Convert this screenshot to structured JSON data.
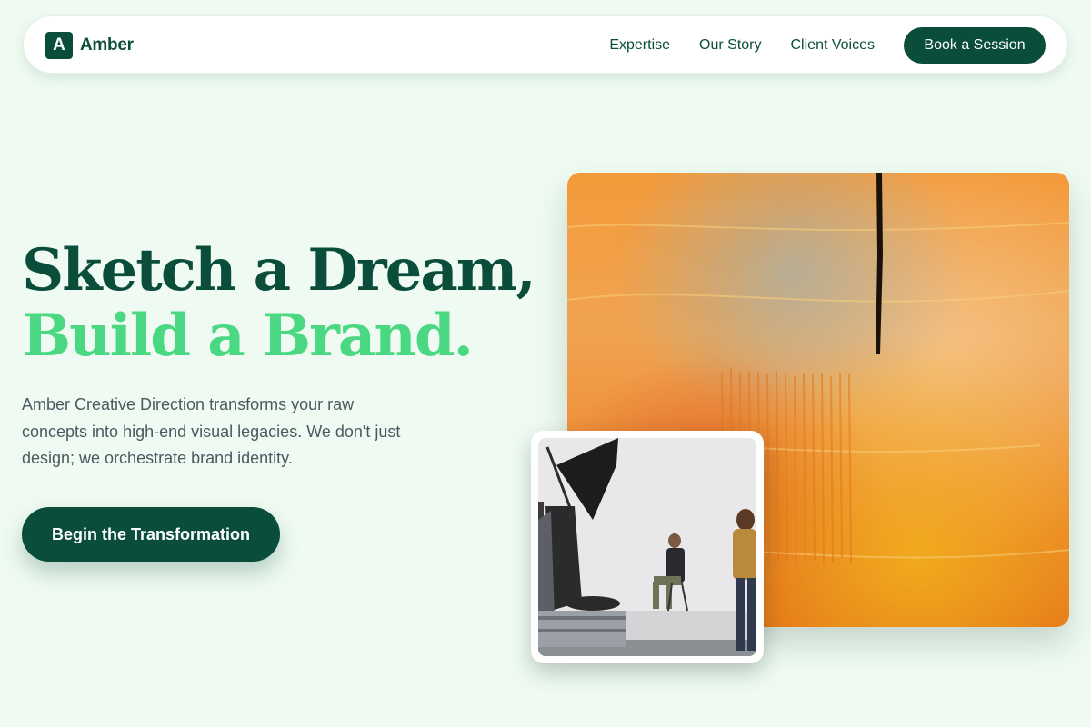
{
  "nav": {
    "logo_letter": "A",
    "brand": "Amber",
    "links": [
      {
        "label": "Expertise"
      },
      {
        "label": "Our Story"
      },
      {
        "label": "Client Voices"
      }
    ],
    "cta": "Book a Session"
  },
  "hero": {
    "title_line1": "Sketch a Dream,",
    "title_line2": "Build a Brand.",
    "description": "Amber Creative Direction transforms your raw concepts into high-end visual legacies. We don't just design; we orchestrate brand identity.",
    "cta": "Begin the Transformation"
  },
  "images": {
    "main": "abstract-orange-textured-painting",
    "inset": "photo-studio-shoot"
  },
  "colors": {
    "background": "#effbf2",
    "primary": "#0b4d3b",
    "accent": "#4ad882",
    "body_text": "#4a5a60"
  }
}
